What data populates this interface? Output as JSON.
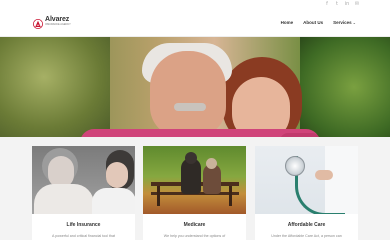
{
  "social": {
    "icons": [
      "facebook-icon",
      "twitter-icon",
      "linkedin-icon",
      "email-icon"
    ],
    "glyphs": [
      "f",
      "t",
      "in",
      "✉"
    ]
  },
  "brand": {
    "name": "Alvarez",
    "tagline": "INSURANCE AGENCY",
    "accent_color": "#c8102e"
  },
  "nav": {
    "items": [
      {
        "label": "Home"
      },
      {
        "label": "About Us"
      },
      {
        "label": "Services"
      }
    ],
    "dropdown_glyph": "⌄"
  },
  "hero": {
    "slides": 3,
    "active_slide": 1
  },
  "cards": [
    {
      "title": "Life Insurance",
      "description": "A powerful and critical financial tool that"
    },
    {
      "title": "Medicare",
      "description": "We help you understand the options of"
    },
    {
      "title": "Affordable Care",
      "description": "Under the Affordable Care Act, a person can"
    }
  ]
}
